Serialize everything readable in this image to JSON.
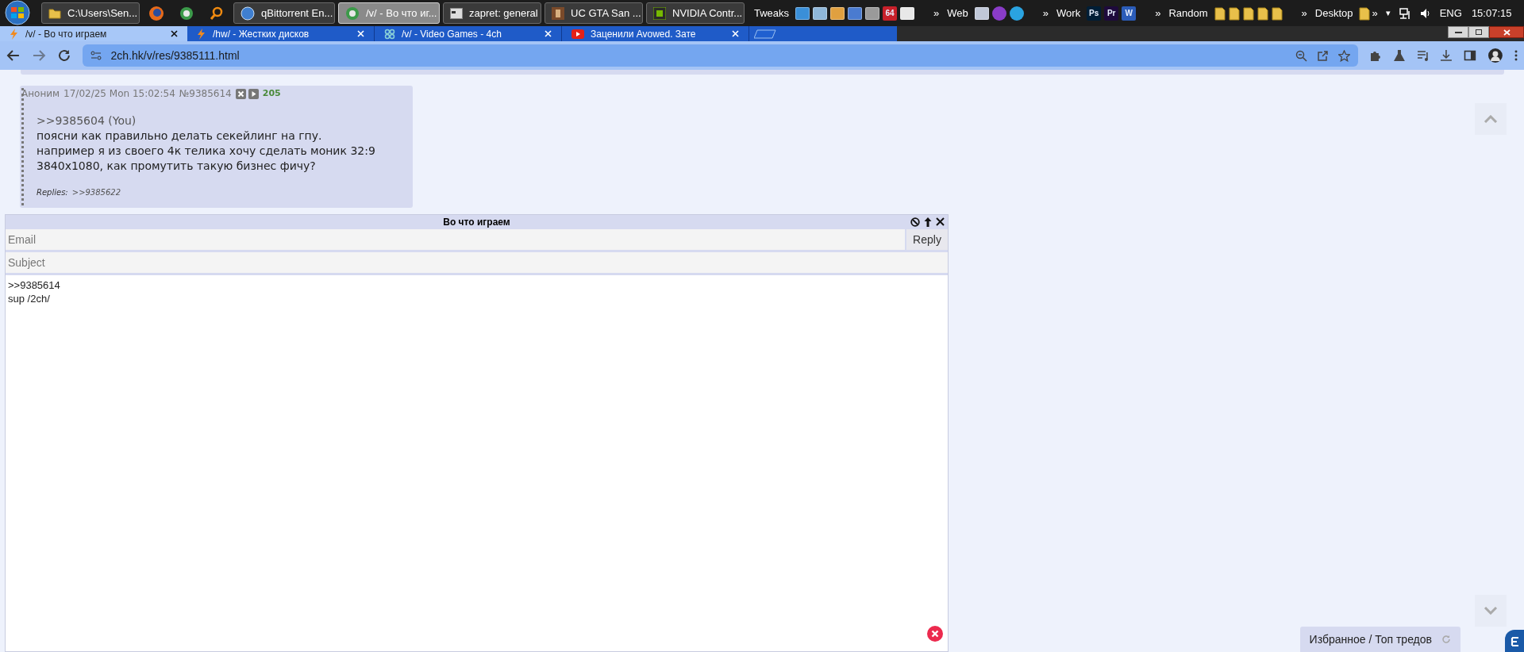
{
  "taskbar": {
    "tasks": [
      {
        "kind": "folder",
        "label": "C:\\Users\\Sen...",
        "selected": false
      },
      {
        "kind": "fox",
        "selected": false
      },
      {
        "kind": "globe",
        "selected": false
      },
      {
        "kind": "search",
        "selected": false
      },
      {
        "kind": "qb",
        "label": "qBittorrent En...",
        "selected": false
      },
      {
        "kind": "globe",
        "label": "/v/ - Во что иг...",
        "selected": true
      },
      {
        "kind": "console",
        "label": "zapret: general",
        "selected": false
      },
      {
        "kind": "game",
        "label": "UC GTA San ...",
        "selected": false
      },
      {
        "kind": "nvidia",
        "label": "NVIDIA Contr...",
        "selected": false
      }
    ],
    "toolbars": [
      {
        "label": "Tweaks",
        "items": [
          {
            "kind": "tile",
            "color": "#3a8fd8"
          },
          {
            "kind": "tile",
            "color": "#8fb7d9"
          },
          {
            "kind": "tile",
            "color": "#e0a040"
          },
          {
            "kind": "tile",
            "color": "#4a7bd0"
          },
          {
            "kind": "tile",
            "color": "#9a9a9a"
          },
          {
            "kind": "letter",
            "text": "64",
            "color": "#c8202a"
          },
          {
            "kind": "tile",
            "color": "#e8e8e8"
          }
        ]
      },
      {
        "chevron": "»",
        "label": "Web",
        "items": [
          {
            "kind": "tile",
            "color": "#c0c8d8"
          },
          {
            "kind": "round",
            "color": "#8a3cc8"
          },
          {
            "kind": "round",
            "color": "#2aa3e0"
          }
        ]
      },
      {
        "chevron": "»",
        "label": "Work",
        "items": [
          {
            "kind": "letter",
            "text": "Ps",
            "color": "#001e36"
          },
          {
            "kind": "letter",
            "text": "Pr",
            "color": "#1e0a3c"
          },
          {
            "kind": "letter",
            "text": "W",
            "color": "#2b5cb8"
          }
        ]
      },
      {
        "chevron": "»",
        "label": "Random",
        "items": [
          {
            "kind": "folder"
          },
          {
            "kind": "folder"
          },
          {
            "kind": "folder"
          },
          {
            "kind": "folder"
          },
          {
            "kind": "folder"
          }
        ]
      },
      {
        "chevron": "»",
        "label": "Desktop",
        "items": [
          {
            "kind": "folder"
          }
        ]
      }
    ],
    "end_chevron": "»",
    "tray_arrow": "▾",
    "language": "ENG",
    "clock": "15:07:15"
  },
  "browser": {
    "tabs": [
      {
        "kind": "bolt",
        "title": "/v/ - Во что играем",
        "selected": true
      },
      {
        "kind": "bolt",
        "title": "/hw/ - Жестких дисков",
        "selected": false
      },
      {
        "kind": "clover",
        "title": "/v/ - Video Games - 4ch",
        "selected": false
      },
      {
        "kind": "video",
        "title": "Заценили Avowed. Зате",
        "selected": false
      }
    ],
    "url": "2ch.hk/v/res/9385111.html"
  },
  "post": {
    "name": "Аноним",
    "date": "17/02/25 Mon 15:02:54",
    "number": "№9385614",
    "count": "205",
    "reply_link": ">>9385604 (You)",
    "lines": [
      "поясни как правильно делать секейлинг на гпу.",
      "например я из своего 4к телика хочу сделать моник 32:9",
      "3840x1080, как промутить такую бизнес фичу?"
    ],
    "replies_label": "Replies:",
    "replies": [
      ">>9385622"
    ]
  },
  "reply_form": {
    "title": "Во что играем",
    "email_placeholder": "Email",
    "submit": "Reply",
    "subject_placeholder": "Subject",
    "message": ">>9385614\nsup /2ch/"
  },
  "favorites": "Избранное / Топ тредов"
}
